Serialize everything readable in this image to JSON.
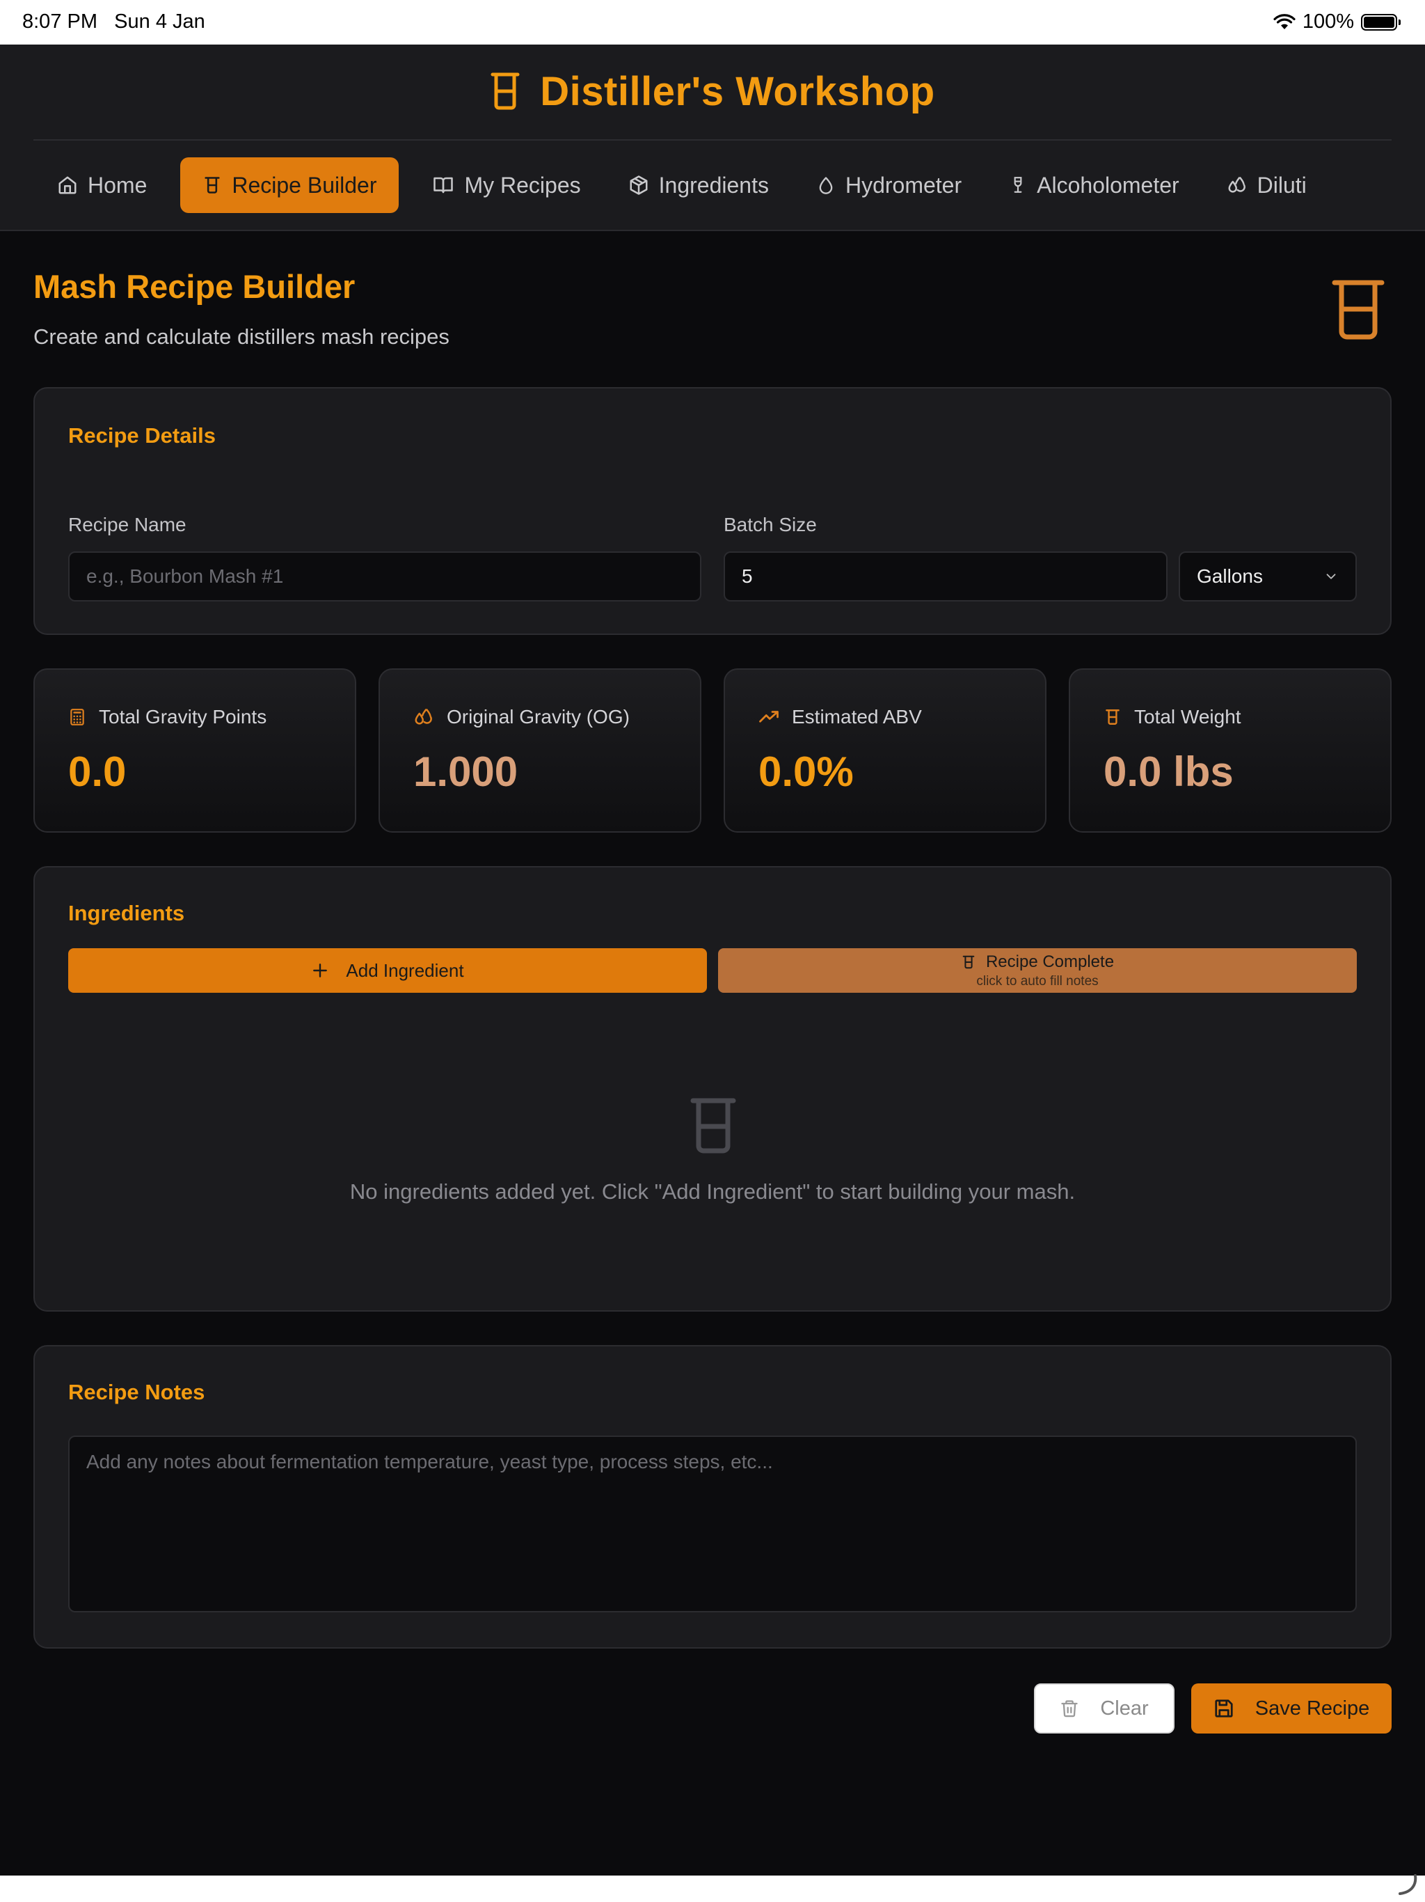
{
  "status_bar": {
    "time": "8:07 PM",
    "date": "Sun 4 Jan",
    "battery": "100%"
  },
  "app": {
    "title": "Distiller's Workshop"
  },
  "nav": {
    "items": [
      {
        "label": "Home",
        "icon": "home-icon"
      },
      {
        "label": "Recipe Builder",
        "icon": "beaker-icon",
        "active": true
      },
      {
        "label": "My Recipes",
        "icon": "book-open-icon"
      },
      {
        "label": "Ingredients",
        "icon": "package-icon"
      },
      {
        "label": "Hydrometer",
        "icon": "droplet-icon"
      },
      {
        "label": "Alcoholometer",
        "icon": "wine-icon"
      },
      {
        "label": "Diluti",
        "icon": "droplets-icon"
      }
    ]
  },
  "page": {
    "title": "Mash Recipe Builder",
    "subtitle": "Create and calculate distillers mash recipes"
  },
  "recipe_details": {
    "title": "Recipe Details",
    "name_label": "Recipe Name",
    "name_placeholder": "e.g., Bourbon Mash #1",
    "name_value": "",
    "batch_label": "Batch Size",
    "batch_value": "5",
    "unit_selected": "Gallons"
  },
  "stats": [
    {
      "label": "Total Gravity Points",
      "value": "0.0",
      "icon": "calculator-icon",
      "value_color": "#f39c12"
    },
    {
      "label": "Original Gravity (OG)",
      "value": "1.000",
      "icon": "droplets-icon",
      "value_color": "#d9a07a"
    },
    {
      "label": "Estimated ABV",
      "value": "0.0%",
      "icon": "trending-up-icon",
      "value_color": "#f39c12"
    },
    {
      "label": "Total Weight",
      "value": "0.0 lbs",
      "icon": "beaker-icon",
      "value_color": "#d9a07a"
    }
  ],
  "ingredients": {
    "title": "Ingredients",
    "add_label": "Add Ingredient",
    "complete_label": "Recipe Complete",
    "complete_sub": "click to auto fill notes",
    "empty_text": "No ingredients added yet. Click \"Add Ingredient\" to start building your mash."
  },
  "notes": {
    "title": "Recipe Notes",
    "placeholder": "Add any notes about fermentation temperature, yeast type, process steps, etc..."
  },
  "actions": {
    "clear_label": "Clear",
    "save_label": "Save Recipe"
  },
  "colors": {
    "accent": "#f39c12",
    "button": "#df7a0c",
    "muted_button": "#b8703a",
    "background": "#0b0b0d",
    "card": "#1b1b1e"
  }
}
